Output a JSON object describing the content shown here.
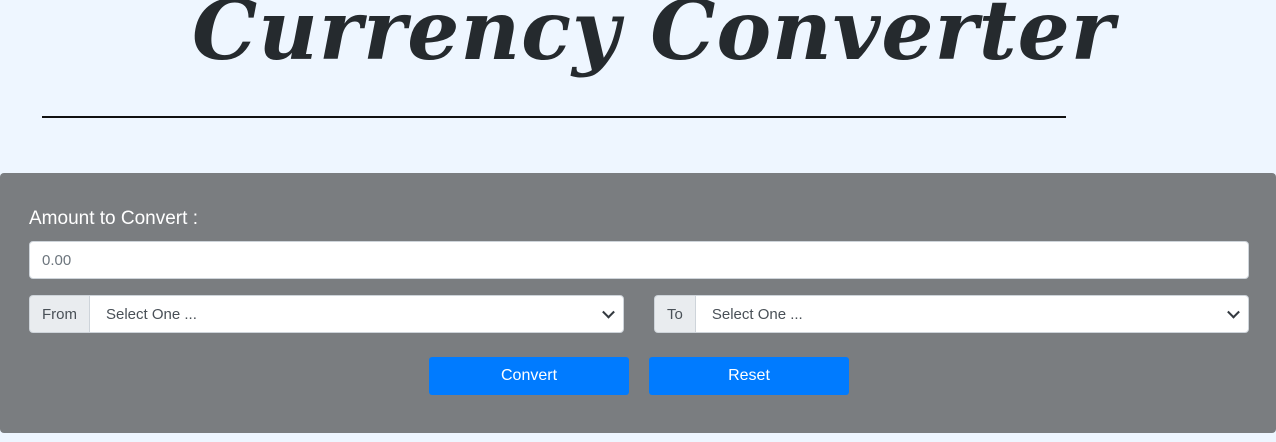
{
  "header": {
    "title": "Currency Converter"
  },
  "form": {
    "amount_label": "Amount to Convert :",
    "amount_placeholder": "0.00",
    "from": {
      "label": "From",
      "selected": "Select One ..."
    },
    "to": {
      "label": "To",
      "selected": "Select One ..."
    },
    "buttons": {
      "convert": "Convert",
      "reset": "Reset"
    }
  },
  "colors": {
    "page_background": "#eef6ff",
    "panel_background": "#7a7d80",
    "button_primary": "#007bff",
    "title_text": "#252a2e"
  },
  "icons": {
    "select_arrow": "chevron-down-icon"
  }
}
